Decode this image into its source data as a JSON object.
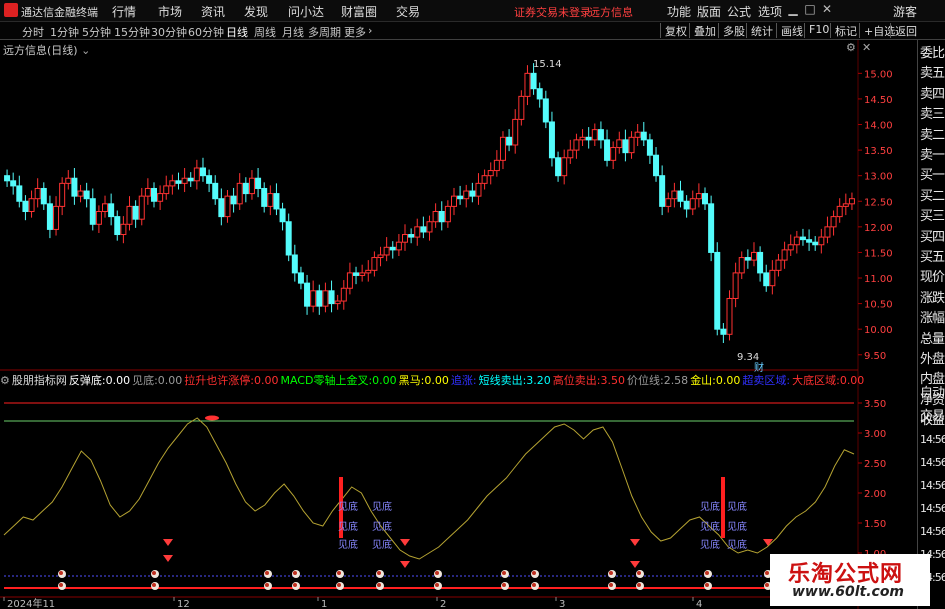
{
  "menubar": {
    "app_name": "通达信金融终端",
    "items": [
      "行情",
      "市场",
      "资讯",
      "发现",
      "问小达",
      "财富圈",
      "交易"
    ],
    "warning": "证券交易未登录",
    "broker": "远方信息",
    "right": [
      "功能",
      "版面",
      "公式",
      "选项"
    ],
    "user": "游客"
  },
  "periods": {
    "items": [
      "分时",
      "1分钟",
      "5分钟",
      "15分钟",
      "30分钟",
      "60分钟",
      "日线",
      "周线",
      "月线",
      "多周期",
      "更多"
    ],
    "active": "日线",
    "right": [
      "复权",
      "叠加",
      "多股",
      "统计",
      "画线",
      "F10",
      "标记",
      "+自选",
      "返回"
    ]
  },
  "chart_title": "远方信息(日线)",
  "sidebar": [
    "委比",
    "卖五",
    "卖四",
    "卖三",
    "卖二",
    "卖一",
    "买一",
    "买二",
    "买三",
    "买四",
    "买五",
    "现价",
    "涨跌",
    "涨幅",
    "总量",
    "外盘",
    "内盘",
    "净资",
    "收益"
  ],
  "sidebar_lower": [
    "自动",
    "交易",
    "14:56",
    "14:56",
    "14:56",
    "14:56",
    "14:56",
    "14:56",
    "14:56"
  ],
  "indicator_header": {
    "name": "股朋指标网",
    "items": [
      {
        "label": "反弹底:",
        "value": "0.00",
        "color": "#ffffff"
      },
      {
        "label": "见底:",
        "value": "0.00",
        "color": "#9a9a9a"
      },
      {
        "label": "拉升也许涨停:",
        "value": "0.00",
        "color": "#ff3030"
      },
      {
        "label": "MACD零轴上金叉:",
        "value": "0.00",
        "color": "#00ff00"
      },
      {
        "label": "黑马:",
        "value": "0.00",
        "color": "#ffff00"
      },
      {
        "label": "追涨:",
        "value": "",
        "color": "#3030ff"
      },
      {
        "label": "短线卖出:",
        "value": "3.20",
        "color": "#00ffff"
      },
      {
        "label": "高位卖出:",
        "value": "3.50",
        "color": "#ff3030"
      },
      {
        "label": "价位线:",
        "value": "2.58",
        "color": "#9a9a9a"
      },
      {
        "label": "金山:",
        "value": "0.00",
        "color": "#ffff00"
      },
      {
        "label": "超卖区域:",
        "value": "",
        "color": "#3030ff"
      },
      {
        "label": "大底区域:",
        "value": "0.00",
        "color": "#ff3030"
      }
    ]
  },
  "price_axis_labels": [
    "15.00",
    "14.50",
    "14.00",
    "13.50",
    "13.00",
    "12.50",
    "12.00",
    "11.50",
    "11.00",
    "10.50",
    "10.00",
    "9.50"
  ],
  "ind_axis_labels": [
    "3.50",
    "3.00",
    "2.50",
    "2.00",
    "1.50",
    "1.00"
  ],
  "date_axis": [
    "2024年11",
    "12",
    "1",
    "2",
    "3",
    "4"
  ],
  "annotations": {
    "high": "15.14",
    "low": "9.34",
    "mark": "财"
  },
  "signal_text": "见底",
  "colors": {
    "up": "#ff3232",
    "down": "#54fcfc",
    "ind_line": "#b5a332",
    "green_line": "#6cd06c",
    "red_line": "#ff2020",
    "gold": "#ffcc00"
  },
  "watermark": {
    "title": "乐淘公式网",
    "url": "www.60lt.com"
  },
  "chart_data": [
    {
      "type": "candlestick",
      "x": [
        1,
        2,
        3,
        4,
        5,
        6,
        7,
        8,
        9,
        10,
        11,
        12,
        13,
        14,
        15,
        16,
        17,
        18,
        19,
        20,
        21,
        22,
        23,
        24,
        25,
        26,
        27,
        28,
        29,
        30,
        31,
        32,
        33,
        34,
        35,
        36,
        37,
        38,
        39,
        40,
        41,
        42,
        43,
        44,
        45,
        46,
        47,
        48,
        49,
        50,
        51,
        52,
        53,
        54,
        55,
        56,
        57,
        58,
        59,
        60,
        61,
        62,
        63,
        64,
        65,
        66,
        67,
        68,
        69,
        70,
        71,
        72,
        73,
        74,
        75,
        76,
        77,
        78,
        79,
        80,
        81,
        82,
        83,
        84,
        85,
        86,
        87,
        88,
        89,
        90,
        91,
        92,
        93,
        94,
        95,
        96,
        97,
        98,
        99,
        100,
        101,
        102,
        103,
        104,
        105,
        106,
        107,
        108,
        109,
        110,
        111,
        112,
        113,
        114,
        115,
        116,
        117,
        118,
        119,
        120,
        121,
        122,
        123,
        124,
        125,
        126,
        127,
        128,
        129,
        130,
        131,
        132,
        133,
        134,
        135,
        136,
        137,
        138,
        139,
        140,
        141
      ],
      "close": [
        12.9,
        12.8,
        12.5,
        12.3,
        12.55,
        12.75,
        12.45,
        11.95,
        12.4,
        12.85,
        12.95,
        12.6,
        12.7,
        12.55,
        12.05,
        12.3,
        12.45,
        12.2,
        11.85,
        12.05,
        12.4,
        12.15,
        12.6,
        12.75,
        12.5,
        12.65,
        12.8,
        12.9,
        12.85,
        12.95,
        12.9,
        13.15,
        13.0,
        12.85,
        12.55,
        12.2,
        12.6,
        12.45,
        12.85,
        12.65,
        12.95,
        12.75,
        12.4,
        12.65,
        12.35,
        12.1,
        11.45,
        11.1,
        10.9,
        10.45,
        10.75,
        10.45,
        10.75,
        10.5,
        10.55,
        10.8,
        11.1,
        11.05,
        11.1,
        11.15,
        11.4,
        11.45,
        11.6,
        11.55,
        11.7,
        11.85,
        11.8,
        12.0,
        11.9,
        12.1,
        12.3,
        12.1,
        12.4,
        12.6,
        12.55,
        12.7,
        12.6,
        12.85,
        13.0,
        13.1,
        13.3,
        13.75,
        13.6,
        14.1,
        14.55,
        15.0,
        14.7,
        14.5,
        14.05,
        13.35,
        13.0,
        13.35,
        13.5,
        13.7,
        13.75,
        13.7,
        13.9,
        13.7,
        13.3,
        13.55,
        13.7,
        13.45,
        13.75,
        13.85,
        13.7,
        13.4,
        13.0,
        12.4,
        12.55,
        12.7,
        12.5,
        12.35,
        12.55,
        12.65,
        12.45,
        11.5,
        10.0,
        9.9,
        10.6,
        11.1,
        11.4,
        11.35,
        11.5,
        11.1,
        10.85,
        11.15,
        11.35,
        11.55,
        11.65,
        11.8,
        11.75,
        11.7,
        11.65,
        11.8,
        12.0,
        12.2,
        12.4,
        12.45,
        12.55
      ],
      "annotations": [
        "15.14",
        "9.34"
      ],
      "ylim": [
        9.3,
        15.3
      ]
    },
    {
      "type": "line",
      "name": "",
      "values": [
        1.3,
        1.45,
        1.6,
        1.55,
        1.7,
        1.85,
        2.1,
        2.4,
        2.7,
        2.55,
        2.2,
        1.8,
        1.6,
        1.7,
        1.9,
        2.2,
        2.5,
        2.75,
        2.95,
        3.15,
        3.25,
        3.1,
        2.8,
        2.5,
        2.15,
        1.85,
        1.7,
        1.8,
        2.0,
        2.15,
        1.95,
        1.7,
        1.5,
        1.45,
        1.7,
        1.9,
        2.1,
        2.0,
        1.7,
        1.45,
        1.25,
        1.05,
        0.95,
        0.9,
        1.0,
        1.1,
        1.25,
        1.4,
        1.55,
        1.75,
        1.95,
        2.1,
        2.25,
        2.45,
        2.65,
        2.8,
        2.95,
        3.1,
        3.15,
        3.05,
        2.9,
        3.05,
        3.1,
        2.85,
        2.4,
        1.95,
        1.6,
        1.35,
        1.2,
        1.25,
        1.4,
        1.55,
        1.6,
        1.45,
        1.3,
        1.1,
        1.0,
        1.05,
        1.0,
        1.1,
        1.25,
        1.45,
        1.6,
        1.7,
        1.85,
        2.1,
        2.45,
        2.72,
        2.65
      ],
      "ylim": [
        0.3,
        3.8
      ]
    }
  ]
}
